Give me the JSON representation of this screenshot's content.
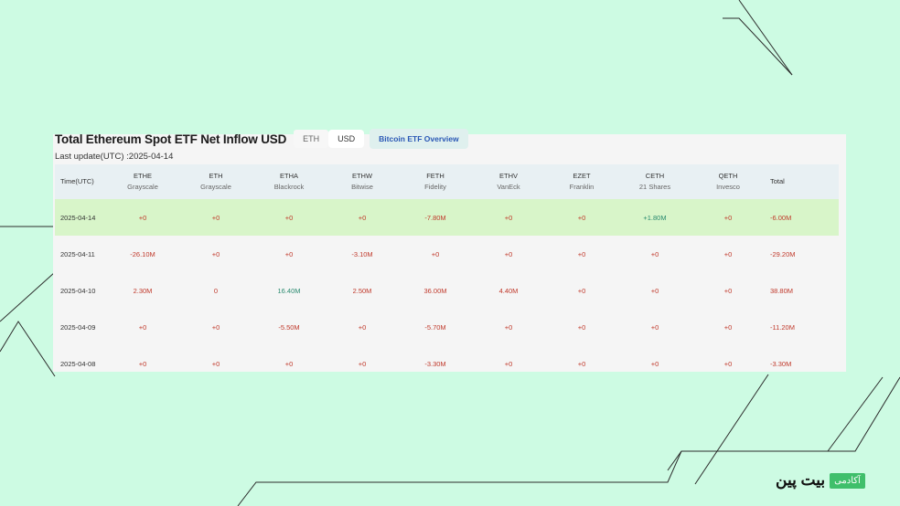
{
  "title": "Total Ethereum Spot ETF Net Inflow USD",
  "toggle": {
    "eth_label": "ETH",
    "usd_label": "USD",
    "active": "USD"
  },
  "overview_button": "Bitcoin ETF Overview",
  "last_update": "Last update(UTC) :2025-04-14",
  "table": {
    "time_header": "Time(UTC)",
    "total_header": "Total",
    "columns": [
      {
        "ticker": "ETHE",
        "issuer": "Grayscale"
      },
      {
        "ticker": "ETH",
        "issuer": "Grayscale"
      },
      {
        "ticker": "ETHA",
        "issuer": "Blackrock"
      },
      {
        "ticker": "ETHW",
        "issuer": "Bitwise"
      },
      {
        "ticker": "FETH",
        "issuer": "Fidelity"
      },
      {
        "ticker": "ETHV",
        "issuer": "VanEck"
      },
      {
        "ticker": "EZET",
        "issuer": "Franklin"
      },
      {
        "ticker": "CETH",
        "issuer": "21 Shares"
      },
      {
        "ticker": "QETH",
        "issuer": "Invesco"
      }
    ],
    "rows": [
      {
        "date": "2025-04-14",
        "values": [
          "+0",
          "+0",
          "+0",
          "+0",
          "-7.80M",
          "+0",
          "+0",
          "+1.80M",
          "+0"
        ],
        "total": "-6.00M"
      },
      {
        "date": "2025-04-11",
        "values": [
          "-26.10M",
          "+0",
          "+0",
          "-3.10M",
          "+0",
          "+0",
          "+0",
          "+0",
          "+0"
        ],
        "total": "-29.20M"
      },
      {
        "date": "2025-04-10",
        "values": [
          "2.30M",
          "0",
          "16.40M",
          "2.50M",
          "36.00M",
          "4.40M",
          "+0",
          "+0",
          "+0"
        ],
        "total": "38.80M"
      },
      {
        "date": "2025-04-09",
        "values": [
          "+0",
          "+0",
          "-5.50M",
          "+0",
          "-5.70M",
          "+0",
          "+0",
          "+0",
          "+0"
        ],
        "total": "-11.20M"
      },
      {
        "date": "2025-04-08",
        "values": [
          "+0",
          "+0",
          "+0",
          "+0",
          "-3.30M",
          "+0",
          "+0",
          "+0",
          "+0"
        ],
        "total": "-3.30M"
      }
    ],
    "positive_color": "#2a8a6f",
    "negative_color": "#c0392b",
    "highlight_row_color": "#d8f5c9"
  },
  "watermark": {
    "brand": "بیت پین",
    "tag": "آکادمی",
    "tag_color": "#3fbf6b"
  },
  "background_color": "#cdfbe3"
}
